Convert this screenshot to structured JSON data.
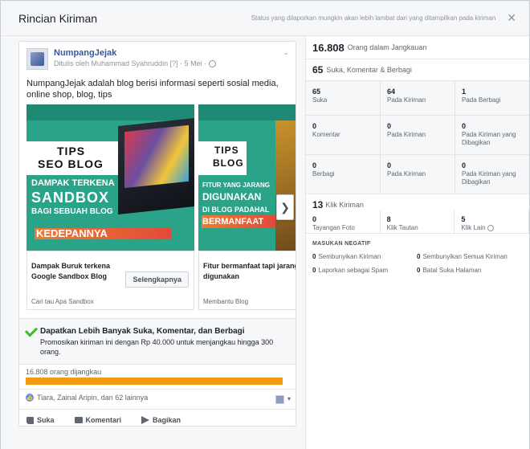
{
  "header": {
    "title": "Rincian Kiriman",
    "note": "Status yang dilaporkan mungkin akan lebih lambat dari yang ditampilkan pada kiriman",
    "close": "✕"
  },
  "post": {
    "page_name": "NumpangJejak",
    "byline": "Ditulis oleh Muhammad Syahruddin [?] · 5 Mei ·",
    "text": "NumpangJejak adalah blog berisi informasi seperti sosial media, online shop, blog, tips",
    "menu_chevron": "⌄",
    "carousel": [
      {
        "img_title1": "TIPS",
        "img_title2": "SEO BLOG",
        "img_line1": "DAMPAK TERKENA",
        "img_line2": "SANDBOX",
        "img_line3": "BAGI SEBUAH BLOG",
        "img_line4": "KEDEPANNYA",
        "caption": "Dampak Buruk terkena Google Sandbox Blog",
        "sub": "Cari tau Apa Sandbox",
        "cta": "Selengkapnya"
      },
      {
        "img_title1": "TIPS",
        "img_title2": "BLOG",
        "img_line1": "FITUR YANG JARANG",
        "img_line2": "DIGUNAKAN",
        "img_line3": "DI BLOG PADAHAL",
        "img_line4": "BERMANFAAT",
        "caption": "Fitur bermanfaat tapi jarang digunakan",
        "sub": "Membantu Blog"
      }
    ],
    "next_arrow": "❯"
  },
  "promo": {
    "title": "Dapatkan Lebih Banyak Suka, Komentar, dan Berbagi",
    "text": "Promosikan kiriman ini dengan Rp 40.000 untuk menjangkau hingga 300 orang."
  },
  "reach": {
    "label": "16.808 orang dijangkau",
    "fill_fraction": 1.0,
    "color": "#f39c12"
  },
  "likes": {
    "badge": "👍",
    "text": "Tiara, Zainal Aripin, dan 62 lainnya"
  },
  "actions": {
    "like": "Suka",
    "comment": "Komentari",
    "share": "Bagikan"
  },
  "stats": {
    "reach_num": "16.808",
    "reach_label": "Orang dalam Jangkauan",
    "eng_num": "65",
    "eng_label": "Suka, Komentar & Berbagi",
    "grid": [
      [
        {
          "v": "65",
          "l": "Suka"
        },
        {
          "v": "64",
          "l": "Pada Kiriman"
        },
        {
          "v": "1",
          "l": "Pada Berbagi"
        }
      ],
      [
        {
          "v": "0",
          "l": "Komentar"
        },
        {
          "v": "0",
          "l": "Pada Kiriman"
        },
        {
          "v": "0",
          "l": "Pada Kiriman yang Dibagikan"
        }
      ],
      [
        {
          "v": "0",
          "l": "Berbagi"
        },
        {
          "v": "0",
          "l": "Pada Kiriman"
        },
        {
          "v": "0",
          "l": "Pada Kiriman yang Dibagikan"
        }
      ]
    ],
    "clicks_num": "13",
    "clicks_label": "Klik Kiriman",
    "clicks": [
      {
        "v": "0",
        "l": "Tayangan Foto"
      },
      {
        "v": "8",
        "l": "Klik Tautan"
      },
      {
        "v": "5",
        "l": "Klik Lain"
      }
    ],
    "neg_head": "MASUKAN NEGATIF",
    "negative": [
      {
        "v": "0",
        "l": "Sembunyikan Kiriman"
      },
      {
        "v": "0",
        "l": "Sembunyikan Semua Kiriman"
      },
      {
        "v": "0",
        "l": "Laporkan sebagai Spam"
      },
      {
        "v": "0",
        "l": "Batal Suka Halaman"
      }
    ]
  }
}
